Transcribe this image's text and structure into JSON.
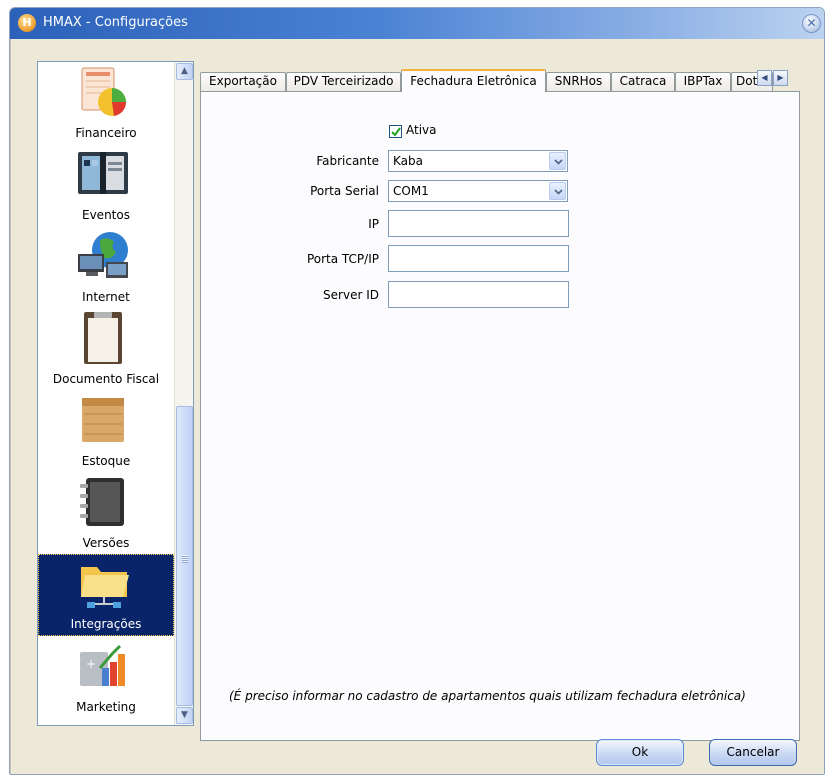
{
  "window": {
    "title": "HMAX - Configurações",
    "close_glyph": "✕"
  },
  "sidebar": {
    "items": [
      {
        "label": "Financeiro",
        "icon": "financial-chart-icon"
      },
      {
        "label": "Eventos",
        "icon": "calendar-book-icon"
      },
      {
        "label": "Internet",
        "icon": "globe-computer-icon"
      },
      {
        "label": "Documento Fiscal",
        "icon": "clipboard-icon"
      },
      {
        "label": "Estoque",
        "icon": "box-icon"
      },
      {
        "label": "Versões",
        "icon": "binder-icon"
      },
      {
        "label": "Integrações",
        "icon": "folder-network-icon",
        "selected": true
      },
      {
        "label": "Marketing",
        "icon": "growth-chart-icon"
      }
    ],
    "scroll_up": "▲",
    "scroll_down": "▼"
  },
  "tabs": [
    {
      "label": "Exportação"
    },
    {
      "label": "PDV Terceirizado"
    },
    {
      "label": "Fechadura Eletrônica",
      "active": true
    },
    {
      "label": "SNRHos"
    },
    {
      "label": "Catraca"
    },
    {
      "label": "IBPTax"
    },
    {
      "label": "Dot"
    }
  ],
  "tab_nav": {
    "prev": "◀",
    "next": "▶"
  },
  "form": {
    "ativa": {
      "label": "Ativa",
      "checked": true
    },
    "fabricante": {
      "label": "Fabricante",
      "value": "Kaba"
    },
    "porta_serial": {
      "label": "Porta Serial",
      "value": "COM1"
    },
    "ip": {
      "label": "IP",
      "value": ""
    },
    "porta_tcp": {
      "label": "Porta TCP/IP",
      "value": ""
    },
    "server_id": {
      "label": "Server ID",
      "value": ""
    },
    "note": "(É preciso informar no cadastro de apartamentos quais utilizam fechadura eletrônica)"
  },
  "buttons": {
    "ok": "Ok",
    "cancel": "Cancelar"
  },
  "colors": {
    "titlebar": "#2b61b8",
    "selected_bg": "#0a246a",
    "tab_accent": "#f3b23a"
  }
}
